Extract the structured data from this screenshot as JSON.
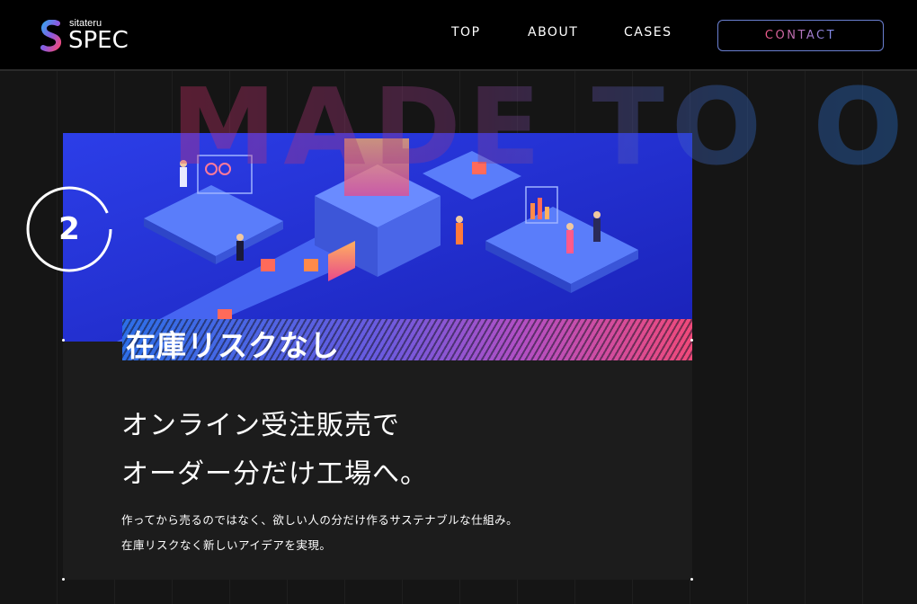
{
  "header": {
    "logo_small": "sitateru",
    "logo_big": "SPEC",
    "nav": [
      {
        "label": "TOP"
      },
      {
        "label": "ABOUT"
      },
      {
        "label": "CASES"
      }
    ],
    "contact_label": "CONTACT"
  },
  "hero": {
    "background_text": "MADE TO O"
  },
  "feature": {
    "number": "2",
    "banner": "在庫リスクなし",
    "headline_line1": "オンライン受注販売で",
    "headline_line2": "オーダー分だけ工場へ。",
    "body_line1": "作ってから売るのではなく、欲しい人の分だけ作るサステナブルな仕組み。",
    "body_line2": "在庫リスクなく新しいアイデアを実現。"
  },
  "colors": {
    "accent_pink": "#f05a8a",
    "accent_blue": "#2d6fe8",
    "background": "#151515"
  }
}
